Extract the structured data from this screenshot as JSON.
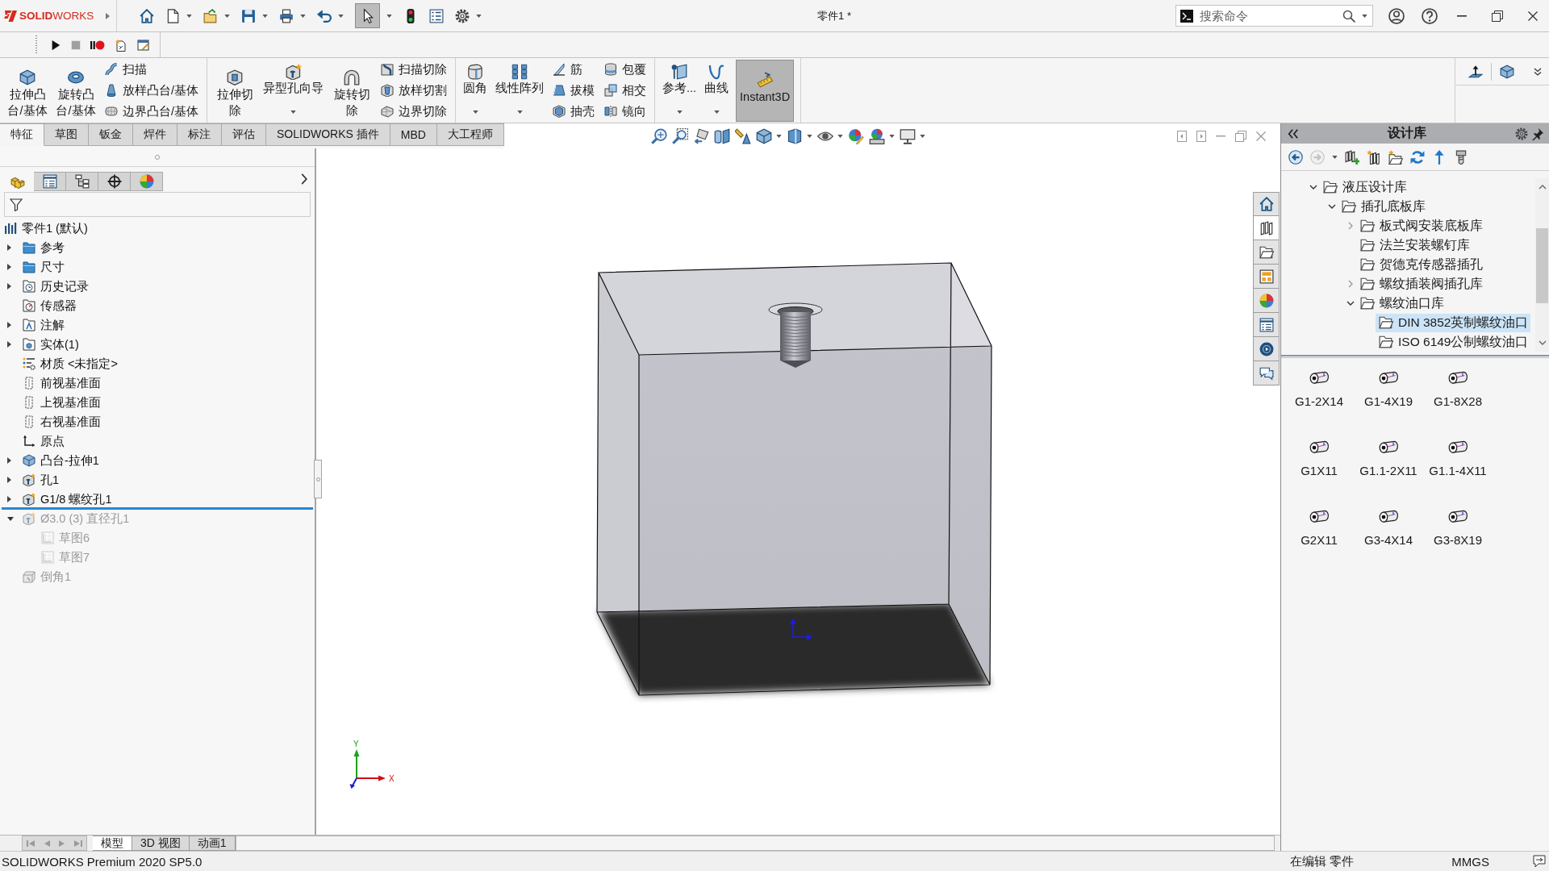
{
  "title_bar": {
    "logo": "**SOLID**WORKS",
    "select_tool_on": true,
    "title": "零件1 *",
    "search": {
      "placeholder": "搜索命令"
    }
  },
  "ribbon": {
    "groups": [
      {
        "buttons": [
          {
            "kind": "large",
            "label": "拉伸凸台/基体"
          },
          {
            "kind": "large",
            "label": "旋转凸台/基体"
          },
          {
            "kind": "stack",
            "items": [
              "扫描",
              "放样凸台/基体",
              "边界凸台/基体"
            ]
          }
        ]
      },
      {
        "buttons": [
          {
            "kind": "large",
            "label": "拉伸切除"
          },
          {
            "kind": "split",
            "label": "异型孔向导"
          },
          {
            "kind": "large",
            "label": "旋转切除"
          },
          {
            "kind": "stack",
            "items": [
              "扫描切除",
              "放样切割",
              "边界切除"
            ]
          }
        ]
      },
      {
        "buttons": [
          {
            "kind": "split",
            "label": "圆角"
          },
          {
            "kind": "split",
            "label": "线性阵列"
          },
          {
            "kind": "stack",
            "items": [
              "筋",
              "拔模",
              "抽壳"
            ]
          },
          {
            "kind": "stack",
            "items": [
              "包覆",
              "相交",
              "镜向"
            ]
          }
        ]
      },
      {
        "buttons": [
          {
            "kind": "split",
            "label": "参考..."
          },
          {
            "kind": "split",
            "label": "曲线"
          },
          {
            "kind": "toggle",
            "label": "Instant3D",
            "on": true
          }
        ]
      }
    ]
  },
  "tabs": [
    {
      "label": "特征",
      "selected": true
    },
    {
      "label": "草图",
      "selected": false
    },
    {
      "label": "钣金",
      "selected": false
    },
    {
      "label": "焊件",
      "selected": false
    },
    {
      "label": "标注",
      "selected": false
    },
    {
      "label": "评估",
      "selected": false
    },
    {
      "label": "SOLIDWORKS 插件",
      "selected": false
    },
    {
      "label": "MBD",
      "selected": false
    },
    {
      "label": "大工程师",
      "selected": false
    }
  ],
  "feature_manager": {
    "panel_tabs": [
      {
        "kind": "features",
        "selected": true
      },
      {
        "kind": "properties",
        "selected": false
      },
      {
        "kind": "configurations",
        "selected": false
      },
      {
        "kind": "dimxpert",
        "selected": false
      },
      {
        "kind": "display",
        "selected": false
      }
    ],
    "tree": {
      "kind": "part",
      "label": "零件1 (默认)",
      "disabled": false,
      "children": [
        {
          "kind": "folder",
          "label": "参考",
          "expanded": false,
          "disabled": false
        },
        {
          "kind": "folder",
          "label": "尺寸",
          "expanded": false,
          "disabled": false
        },
        {
          "kind": "history",
          "label": "历史记录",
          "expanded": false,
          "disabled": false
        },
        {
          "kind": "sensor",
          "label": "传感器",
          "disabled": false
        },
        {
          "kind": "annotations",
          "label": "注解",
          "expanded": false,
          "disabled": false
        },
        {
          "kind": "bodies",
          "label": "实体(1)",
          "expanded": false,
          "disabled": false
        },
        {
          "kind": "material",
          "label": "材质 <未指定>",
          "disabled": false
        },
        {
          "kind": "plane",
          "label": "前视基准面",
          "disabled": false
        },
        {
          "kind": "plane",
          "label": "上视基准面",
          "disabled": false
        },
        {
          "kind": "plane",
          "label": "右视基准面",
          "disabled": false
        },
        {
          "kind": "origin",
          "label": "原点",
          "disabled": false
        },
        {
          "kind": "extrude",
          "label": "凸台-拉伸1",
          "expanded": false,
          "disabled": false
        },
        {
          "kind": "hole",
          "label": "孔1",
          "expanded": false,
          "disabled": false
        },
        {
          "kind": "hole",
          "label": "G1/8 螺纹孔1",
          "expanded": false,
          "disabled": false
        },
        {
          "kind": "rollback"
        },
        {
          "kind": "hole",
          "label": "Ø3.0 (3) 直径孔1",
          "expanded": true,
          "disabled": true,
          "children": [
            {
              "kind": "sketch",
              "label": "草图6",
              "disabled": true
            },
            {
              "kind": "sketch",
              "label": "草图7",
              "disabled": true
            }
          ]
        },
        {
          "kind": "chamfer",
          "label": "倒角1",
          "disabled": true
        }
      ]
    }
  },
  "viewport": {
    "triad": {
      "y_label": "Y",
      "x_label": "X"
    }
  },
  "task_tabs": [
    {
      "kind": "home",
      "selected": false
    },
    {
      "kind": "design-library",
      "selected": true
    },
    {
      "kind": "file-explorer",
      "selected": false
    },
    {
      "kind": "view-palette",
      "selected": false
    },
    {
      "kind": "appearances",
      "selected": false
    },
    {
      "kind": "custom-properties",
      "selected": false
    },
    {
      "kind": "resources",
      "selected": false
    },
    {
      "kind": "forum",
      "selected": false
    }
  ],
  "design_library": {
    "title": "设计库",
    "back_disabled": false,
    "forward_disabled": true,
    "tree": [
      {
        "label": "液压设计库",
        "expanded": true,
        "selected": false,
        "children": [
          {
            "label": "插孔底板库",
            "expanded": true,
            "selected": false,
            "children": [
              {
                "label": "板式阀安装底板库",
                "expanded": false,
                "selected": false
              },
              {
                "label": "法兰安装螺钉库",
                "selected": false
              },
              {
                "label": "贺德克传感器插孔",
                "selected": false
              },
              {
                "label": "螺纹插装阀插孔库",
                "expanded": false,
                "selected": false
              },
              {
                "label": "螺纹油口库",
                "expanded": true,
                "selected": false,
                "children": [
                  {
                    "label": "DIN 3852英制螺纹油口",
                    "selected": true
                  },
                  {
                    "label": "ISO 6149公制螺纹油口",
                    "selected": false
                  }
                ]
              }
            ]
          }
        ]
      }
    ],
    "items": [
      {
        "label": "G1-2X14"
      },
      {
        "label": "G1-4X19"
      },
      {
        "label": "G1-8X28"
      },
      {
        "label": "G1X11"
      },
      {
        "label": "G1.1-2X11"
      },
      {
        "label": "G1.1-4X11"
      },
      {
        "label": "G2X11"
      },
      {
        "label": "G3-4X14"
      },
      {
        "label": "G3-8X19"
      }
    ]
  },
  "model_tabs": [
    {
      "label": "模型",
      "selected": true
    },
    {
      "label": "3D 视图",
      "selected": false
    },
    {
      "label": "动画1",
      "selected": false
    }
  ],
  "status_bar": {
    "product": "SOLIDWORKS Premium 2020 SP5.0",
    "mode": "在编辑 零件",
    "units": "MMGS"
  }
}
